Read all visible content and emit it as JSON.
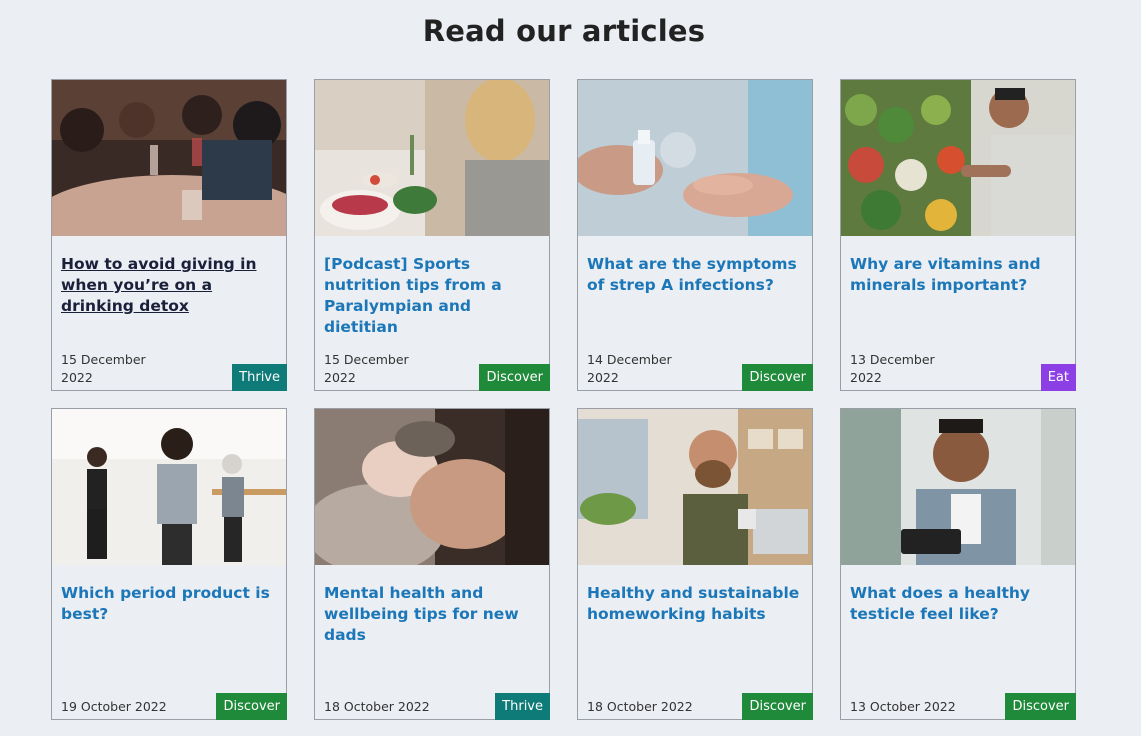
{
  "heading": "Read our articles",
  "articles": [
    {
      "title": "How to avoid giving in when you’re on a drinking detox",
      "date": "15 December 2022",
      "category": "Thrive",
      "image": "people-drinking-at-bar-image"
    },
    {
      "title": "[Podcast] Sports nutrition tips from a Paralympian and dietitian",
      "date": "15 December 2022",
      "category": "Discover",
      "image": "woman-preparing-salad-image"
    },
    {
      "title": "What are the symptoms of strep A infections?",
      "date": "14 December 2022",
      "category": "Discover",
      "image": "hand-sanitiser-spray-image"
    },
    {
      "title": "Why are vitamins and minerals important?",
      "date": "13 December 2022",
      "category": "Eat",
      "image": "man-shopping-vegetables-image"
    },
    {
      "title": "Which period product is best?",
      "date": "19 October 2022",
      "category": "Discover",
      "image": "women-dancing-fitness-class-image"
    },
    {
      "title": "Mental health and wellbeing tips for new dads",
      "date": "18 October 2022",
      "category": "Thrive",
      "image": "dad-with-newborn-baby-image"
    },
    {
      "title": "Healthy and sustainable homeworking habits",
      "date": "18 October 2022",
      "category": "Discover",
      "image": "man-working-from-home-image"
    },
    {
      "title": "What does a healthy testicle feel like?",
      "date": "13 October 2022",
      "category": "Discover",
      "image": "man-reading-tablet-image"
    }
  ],
  "colors": {
    "thrive": "#0f7b78",
    "discover": "#1e8a3a",
    "eat": "#8c3fe5",
    "link": "#1b77b8"
  }
}
